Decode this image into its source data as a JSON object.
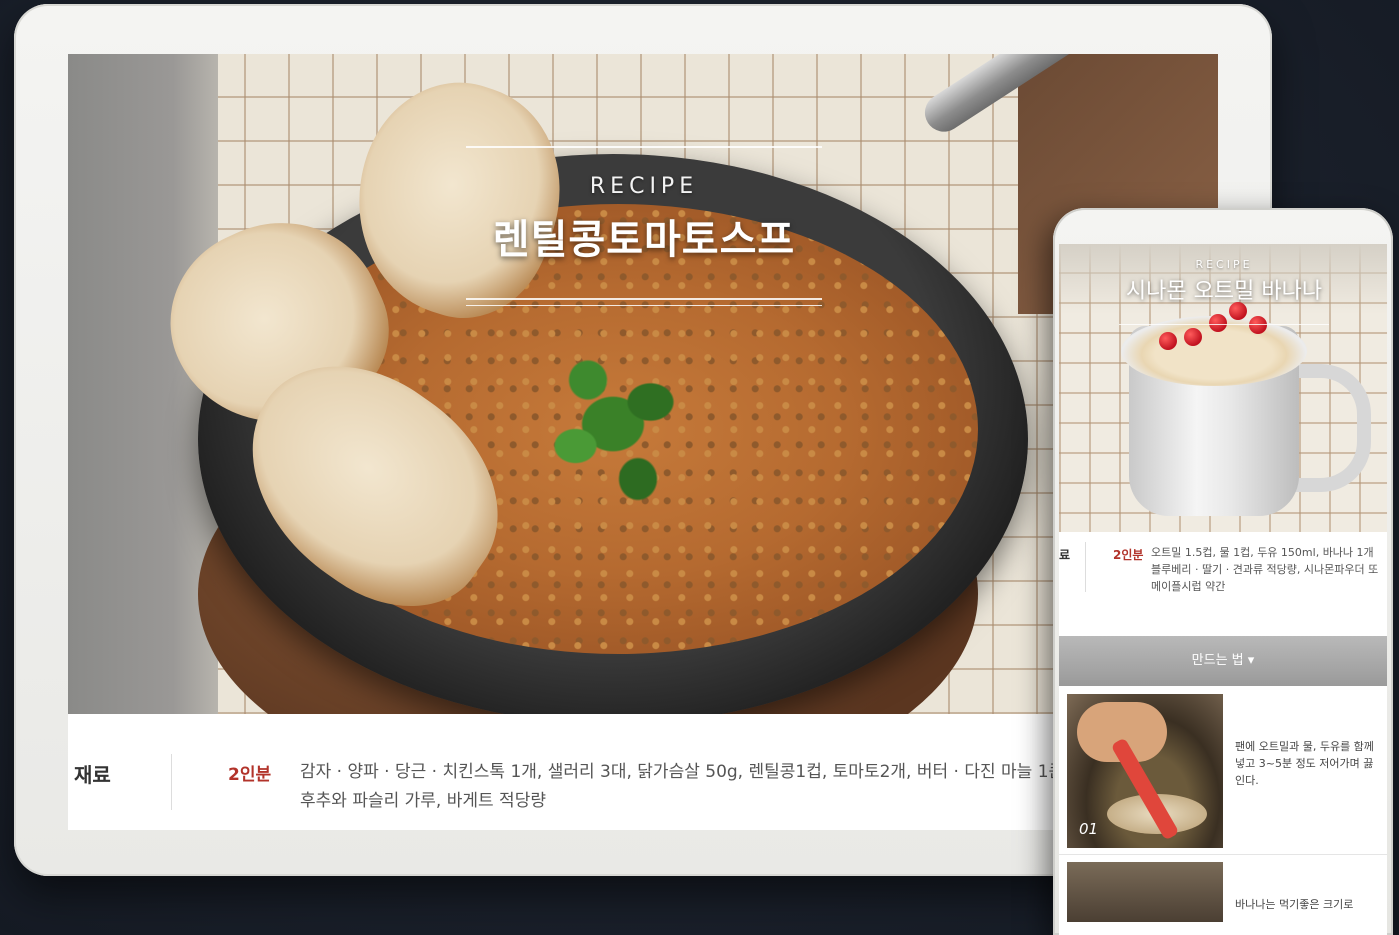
{
  "tablet": {
    "recipe_label": "RECIPE",
    "recipe_title": "렌틸콩토마토스프",
    "ingredients": {
      "label": "재료",
      "servings": "2인분",
      "line1": "감자 · 양파 · 당근 · 치킨스톡 1개, 샐러리 3대, 닭가슴살 50g, 렌틸콩1컵, 토마토2개, 버터 · 다진 마늘 1큰술",
      "line2": "후추와 파슬리 가루, 바게트 적당량"
    }
  },
  "phone": {
    "recipe_label": "RECIPE",
    "recipe_title": "시나몬 오트밀 바나나",
    "ingredients": {
      "label": "료",
      "servings": "2인분",
      "text": "오트밀 1.5컵, 물 1컵, 두유 150ml, 바나나 1개 블루베리 · 딸기 · 견과류 적당량, 시나몬파우더 또 메이플시럽 약간"
    },
    "howto_label": "만드는 법 ▾",
    "steps": [
      {
        "number": "01",
        "text": "팬에 오트밀과 물, 두유를 함께 넣고 3~5분 정도 저어가며 끓인다."
      },
      {
        "number": "",
        "text": "바나나는 먹기좋은 크기로"
      }
    ]
  }
}
